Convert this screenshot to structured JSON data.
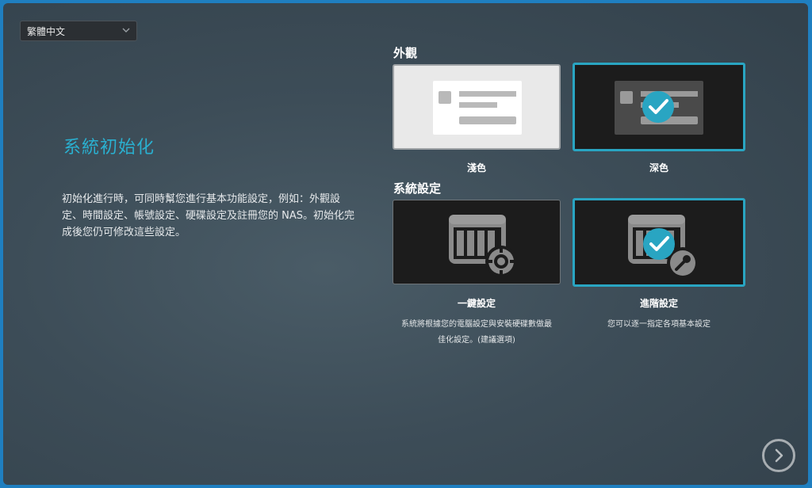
{
  "language": {
    "selected": "繁體中文"
  },
  "intro": {
    "title": "系統初始化",
    "description": "初始化進行時，可同時幫您進行基本功能設定，例如：外觀設定、時間設定、帳號設定、硬碟設定及註冊您的 NAS。初始化完成後您仍可修改這些設定。"
  },
  "appearance": {
    "label": "外觀",
    "options": [
      {
        "label": "淺色",
        "selected": false
      },
      {
        "label": "深色",
        "selected": true
      }
    ]
  },
  "system_settings": {
    "label": "系統設定",
    "options": [
      {
        "label": "一鍵設定",
        "description_line1": "系統將根據您的電腦設定與安裝硬碟數做最",
        "description_line2": "佳化設定。(建議選項)",
        "selected": false
      },
      {
        "label": "進階設定",
        "description_line1": "您可以逐一指定各項基本設定",
        "selected": true
      }
    ]
  },
  "colors": {
    "accent": "#29a5c2",
    "title": "#2ab0d0"
  },
  "icons": {
    "next": "chevron-right-icon",
    "language_dropdown": "chevron-down-icon",
    "selected": "check-circle-icon"
  }
}
